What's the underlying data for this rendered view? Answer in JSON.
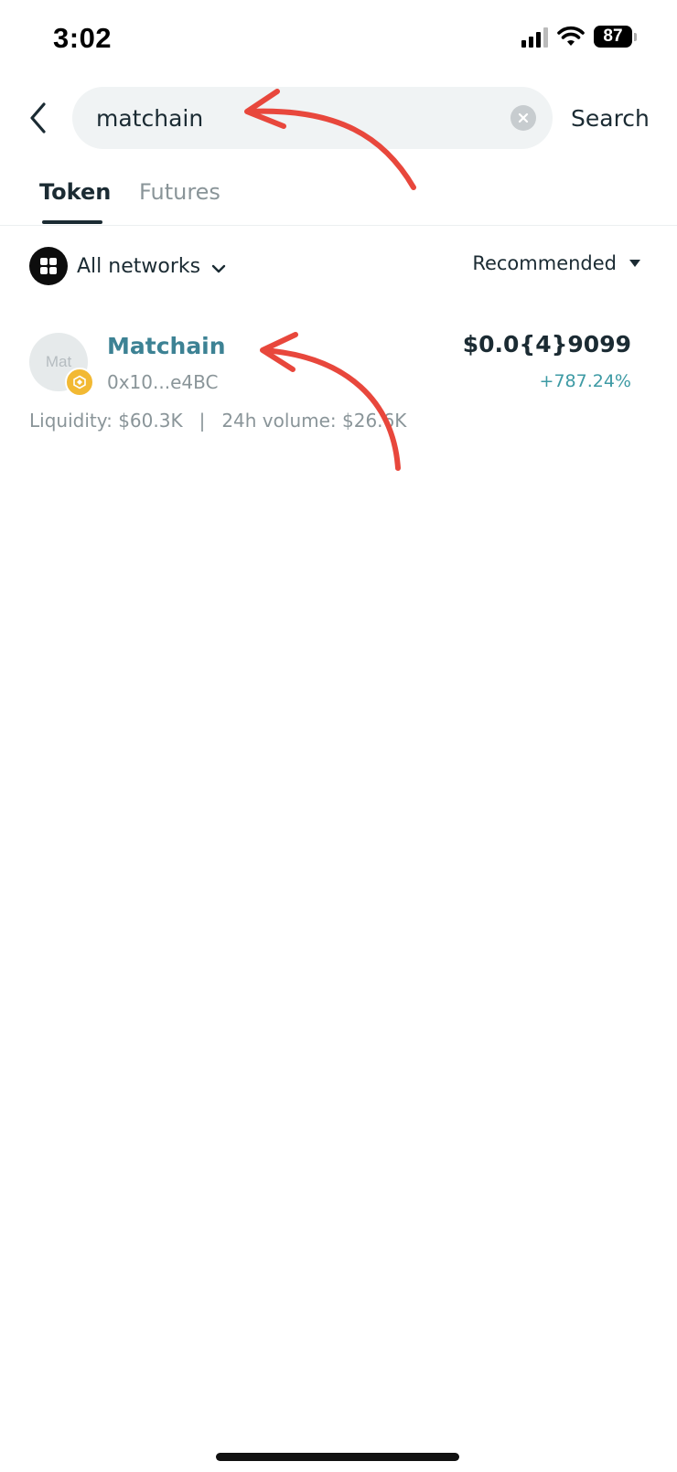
{
  "status_bar": {
    "time": "3:02",
    "battery_level": "87"
  },
  "search": {
    "query": "matchain",
    "action_label": "Search"
  },
  "tabs": [
    {
      "label": "Token",
      "active": true
    },
    {
      "label": "Futures",
      "active": false
    }
  ],
  "filters": {
    "network_label": "All networks",
    "sort_label": "Recommended"
  },
  "results": [
    {
      "avatar_text": "Mat",
      "name": "Matchain",
      "address": "0x10...e4BC",
      "price": "$0.0{4}9099",
      "change": "+787.24%",
      "liquidity": "Liquidity: $60.3K",
      "separator": "|",
      "volume": "24h volume: $26.6K"
    }
  ],
  "colors": {
    "accent_teal": "#3d8294",
    "positive": "#3d9aa4",
    "annotation_red": "#e8473c",
    "chain_badge": "#f2b933"
  }
}
